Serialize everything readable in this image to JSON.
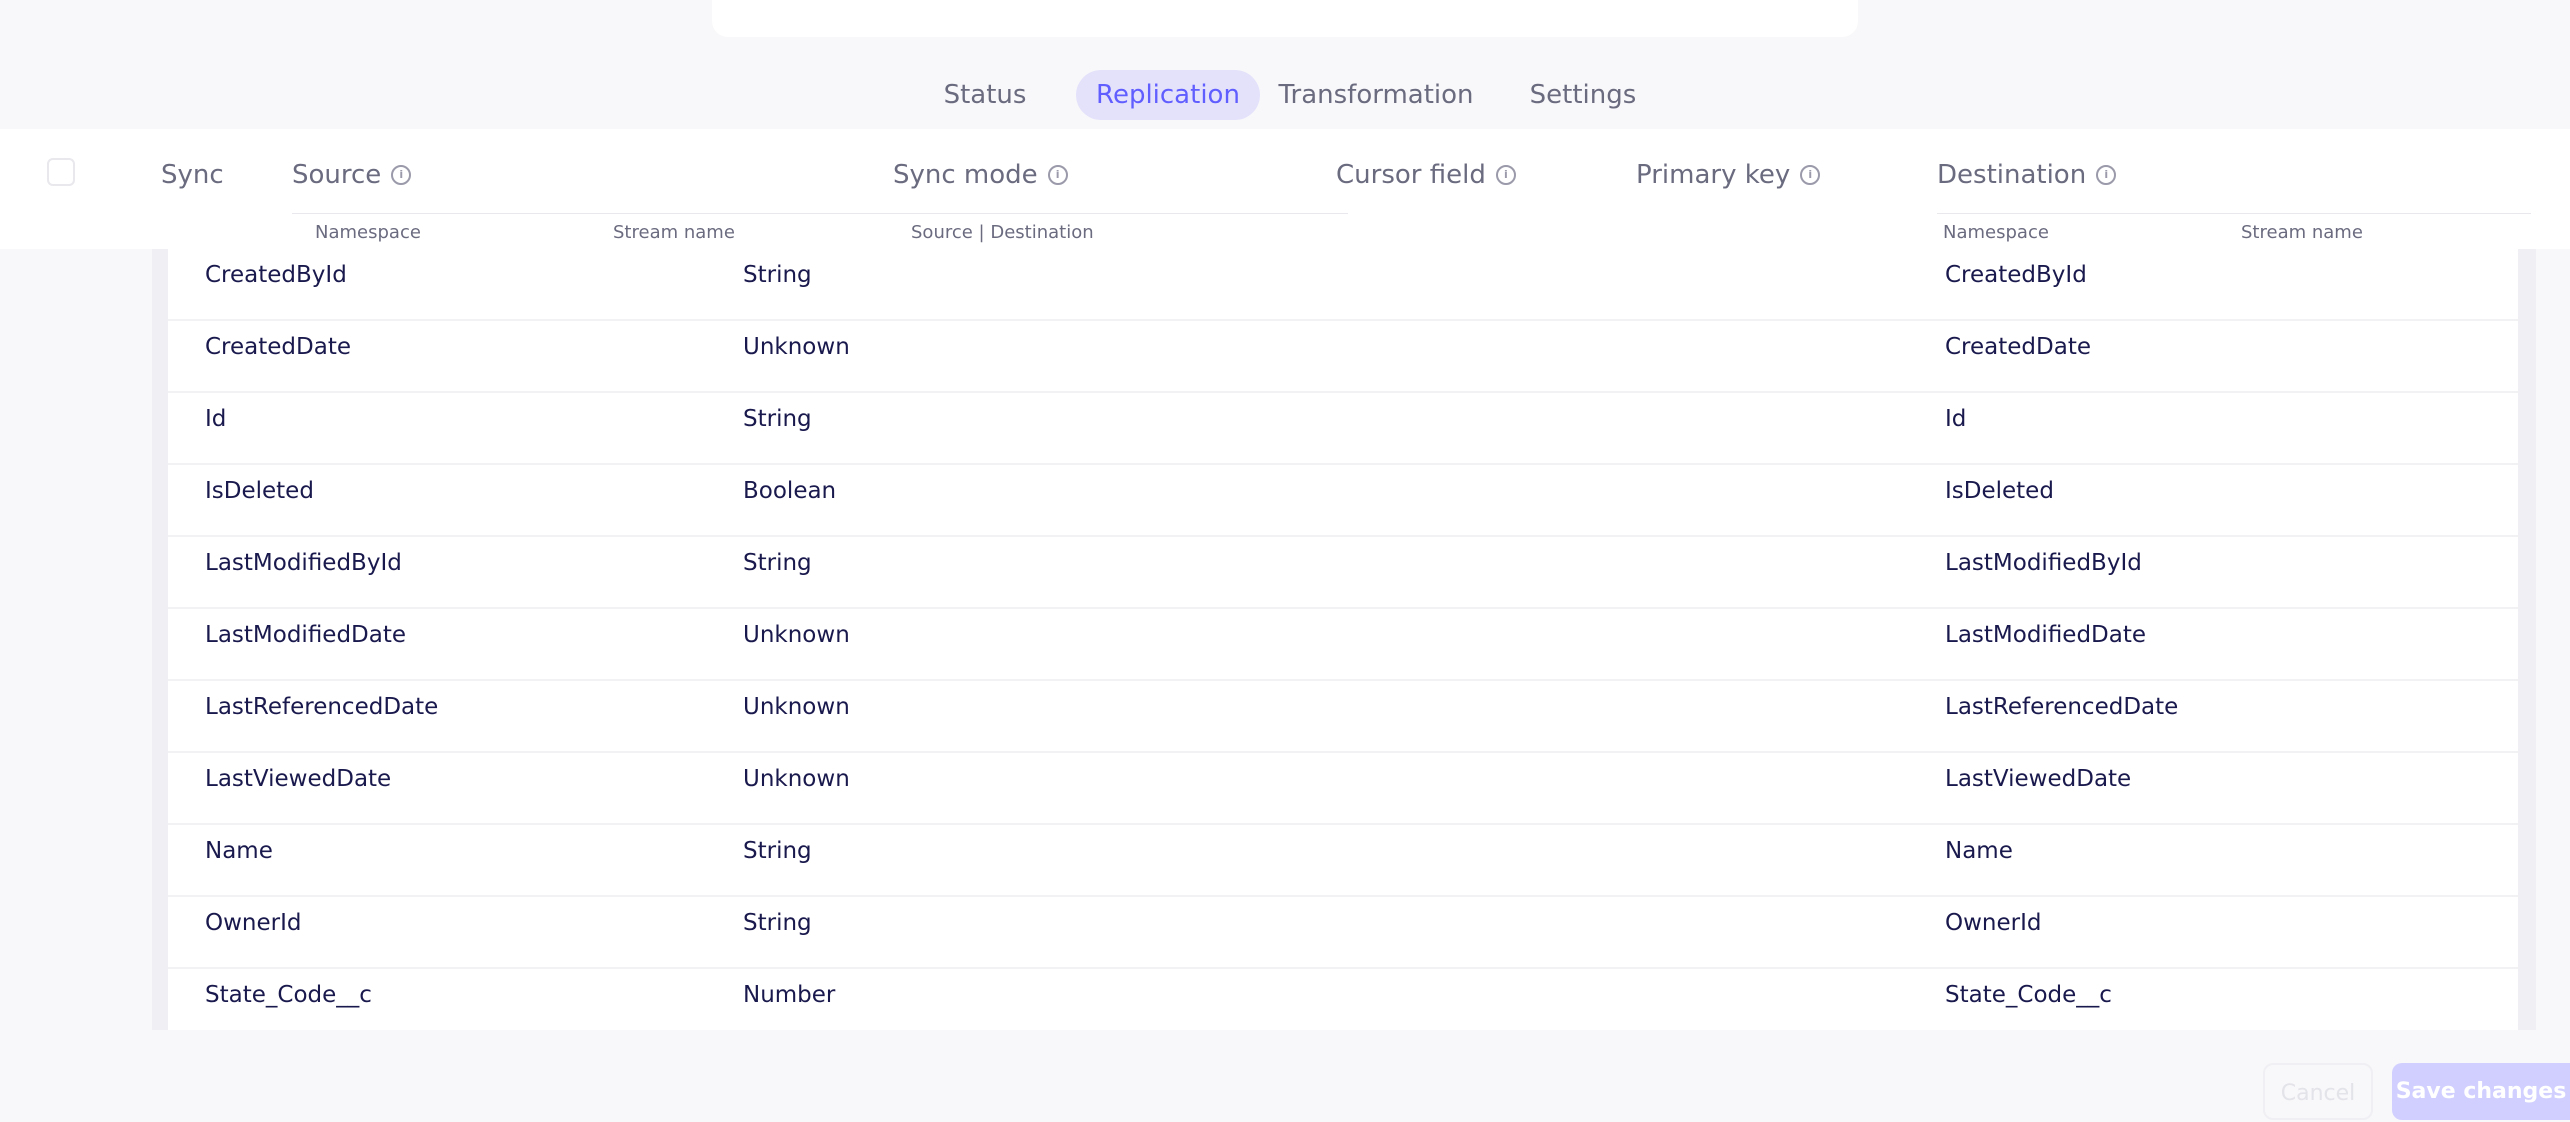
{
  "tabs": [
    {
      "label": "Status",
      "active": false
    },
    {
      "label": "Replication",
      "active": true
    },
    {
      "label": "Transformation",
      "active": false
    },
    {
      "label": "Settings",
      "active": false
    }
  ],
  "columns": {
    "sync": "Sync",
    "source": "Source",
    "sync_mode": "Sync mode",
    "cursor_field": "Cursor field",
    "primary_key": "Primary key",
    "destination": "Destination"
  },
  "subcolumns": {
    "source_namespace": "Namespace",
    "source_stream_name": "Stream name",
    "sync_mode_detail": "Source | Destination",
    "destination_namespace": "Namespace",
    "destination_stream_name": "Stream name"
  },
  "rows": [
    {
      "field": "CreatedById",
      "type": "String",
      "dest_field": "CreatedById"
    },
    {
      "field": "CreatedDate",
      "type": "Unknown",
      "dest_field": "CreatedDate"
    },
    {
      "field": "Id",
      "type": "String",
      "dest_field": "Id"
    },
    {
      "field": "IsDeleted",
      "type": "Boolean",
      "dest_field": "IsDeleted"
    },
    {
      "field": "LastModifiedById",
      "type": "String",
      "dest_field": "LastModifiedById"
    },
    {
      "field": "LastModifiedDate",
      "type": "Unknown",
      "dest_field": "LastModifiedDate"
    },
    {
      "field": "LastReferencedDate",
      "type": "Unknown",
      "dest_field": "LastReferencedDate"
    },
    {
      "field": "LastViewedDate",
      "type": "Unknown",
      "dest_field": "LastViewedDate"
    },
    {
      "field": "Name",
      "type": "String",
      "dest_field": "Name"
    },
    {
      "field": "OwnerId",
      "type": "String",
      "dest_field": "OwnerId"
    },
    {
      "field": "State_Code__c",
      "type": "Number",
      "dest_field": "State_Code__c"
    }
  ],
  "buttons": {
    "cancel": "Cancel",
    "save": "Save changes"
  },
  "colors": {
    "accent": "#615eff",
    "accent_light": "#e4e2fb",
    "save_disabled": "#d0cfff"
  },
  "icons": {
    "info": "info-circle-icon"
  }
}
